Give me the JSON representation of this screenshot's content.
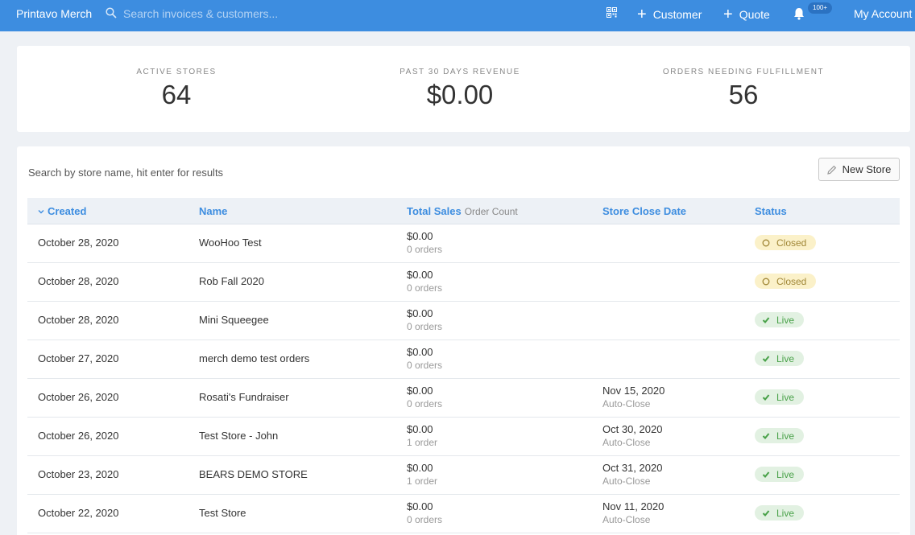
{
  "topbar": {
    "brand": "Printavo Merch",
    "search_placeholder": "Search invoices & customers...",
    "customer_label": "Customer",
    "quote_label": "Quote",
    "notification_count": "100+",
    "account_label": "My Account",
    "accent_color": "#3d8de0"
  },
  "stats": [
    {
      "label": "ACTIVE STORES",
      "value": "64"
    },
    {
      "label": "PAST 30 DAYS REVENUE",
      "value": "$0.00"
    },
    {
      "label": "ORDERS NEEDING FULFILLMENT",
      "value": "56"
    }
  ],
  "stores": {
    "search_placeholder": "Search by store name, hit enter for results",
    "new_store_label": "New Store",
    "columns": {
      "created": "Created",
      "name": "Name",
      "total_sales": "Total Sales",
      "order_count": "Order Count",
      "close_date": "Store Close Date",
      "status": "Status"
    },
    "rows": [
      {
        "created": "October 28, 2020",
        "name": "WooHoo Test",
        "sales": "$0.00",
        "orders": "0 orders",
        "close_date": "",
        "close_note": "",
        "status": "Closed"
      },
      {
        "created": "October 28, 2020",
        "name": "Rob Fall 2020",
        "sales": "$0.00",
        "orders": "0 orders",
        "close_date": "",
        "close_note": "",
        "status": "Closed"
      },
      {
        "created": "October 28, 2020",
        "name": "Mini Squeegee",
        "sales": "$0.00",
        "orders": "0 orders",
        "close_date": "",
        "close_note": "",
        "status": "Live"
      },
      {
        "created": "October 27, 2020",
        "name": "merch demo test orders",
        "sales": "$0.00",
        "orders": "0 orders",
        "close_date": "",
        "close_note": "",
        "status": "Live"
      },
      {
        "created": "October 26, 2020",
        "name": "Rosati's Fundraiser",
        "sales": "$0.00",
        "orders": "0 orders",
        "close_date": "Nov 15, 2020",
        "close_note": "Auto-Close",
        "status": "Live"
      },
      {
        "created": "October 26, 2020",
        "name": "Test Store - John",
        "sales": "$0.00",
        "orders": "1 order",
        "close_date": "Oct 30, 2020",
        "close_note": "Auto-Close",
        "status": "Live"
      },
      {
        "created": "October 23, 2020",
        "name": "BEARS DEMO STORE",
        "sales": "$0.00",
        "orders": "1 order",
        "close_date": "Oct 31, 2020",
        "close_note": "Auto-Close",
        "status": "Live"
      },
      {
        "created": "October 22, 2020",
        "name": "Test Store",
        "sales": "$0.00",
        "orders": "0 orders",
        "close_date": "Nov 11, 2020",
        "close_note": "Auto-Close",
        "status": "Live"
      }
    ]
  }
}
